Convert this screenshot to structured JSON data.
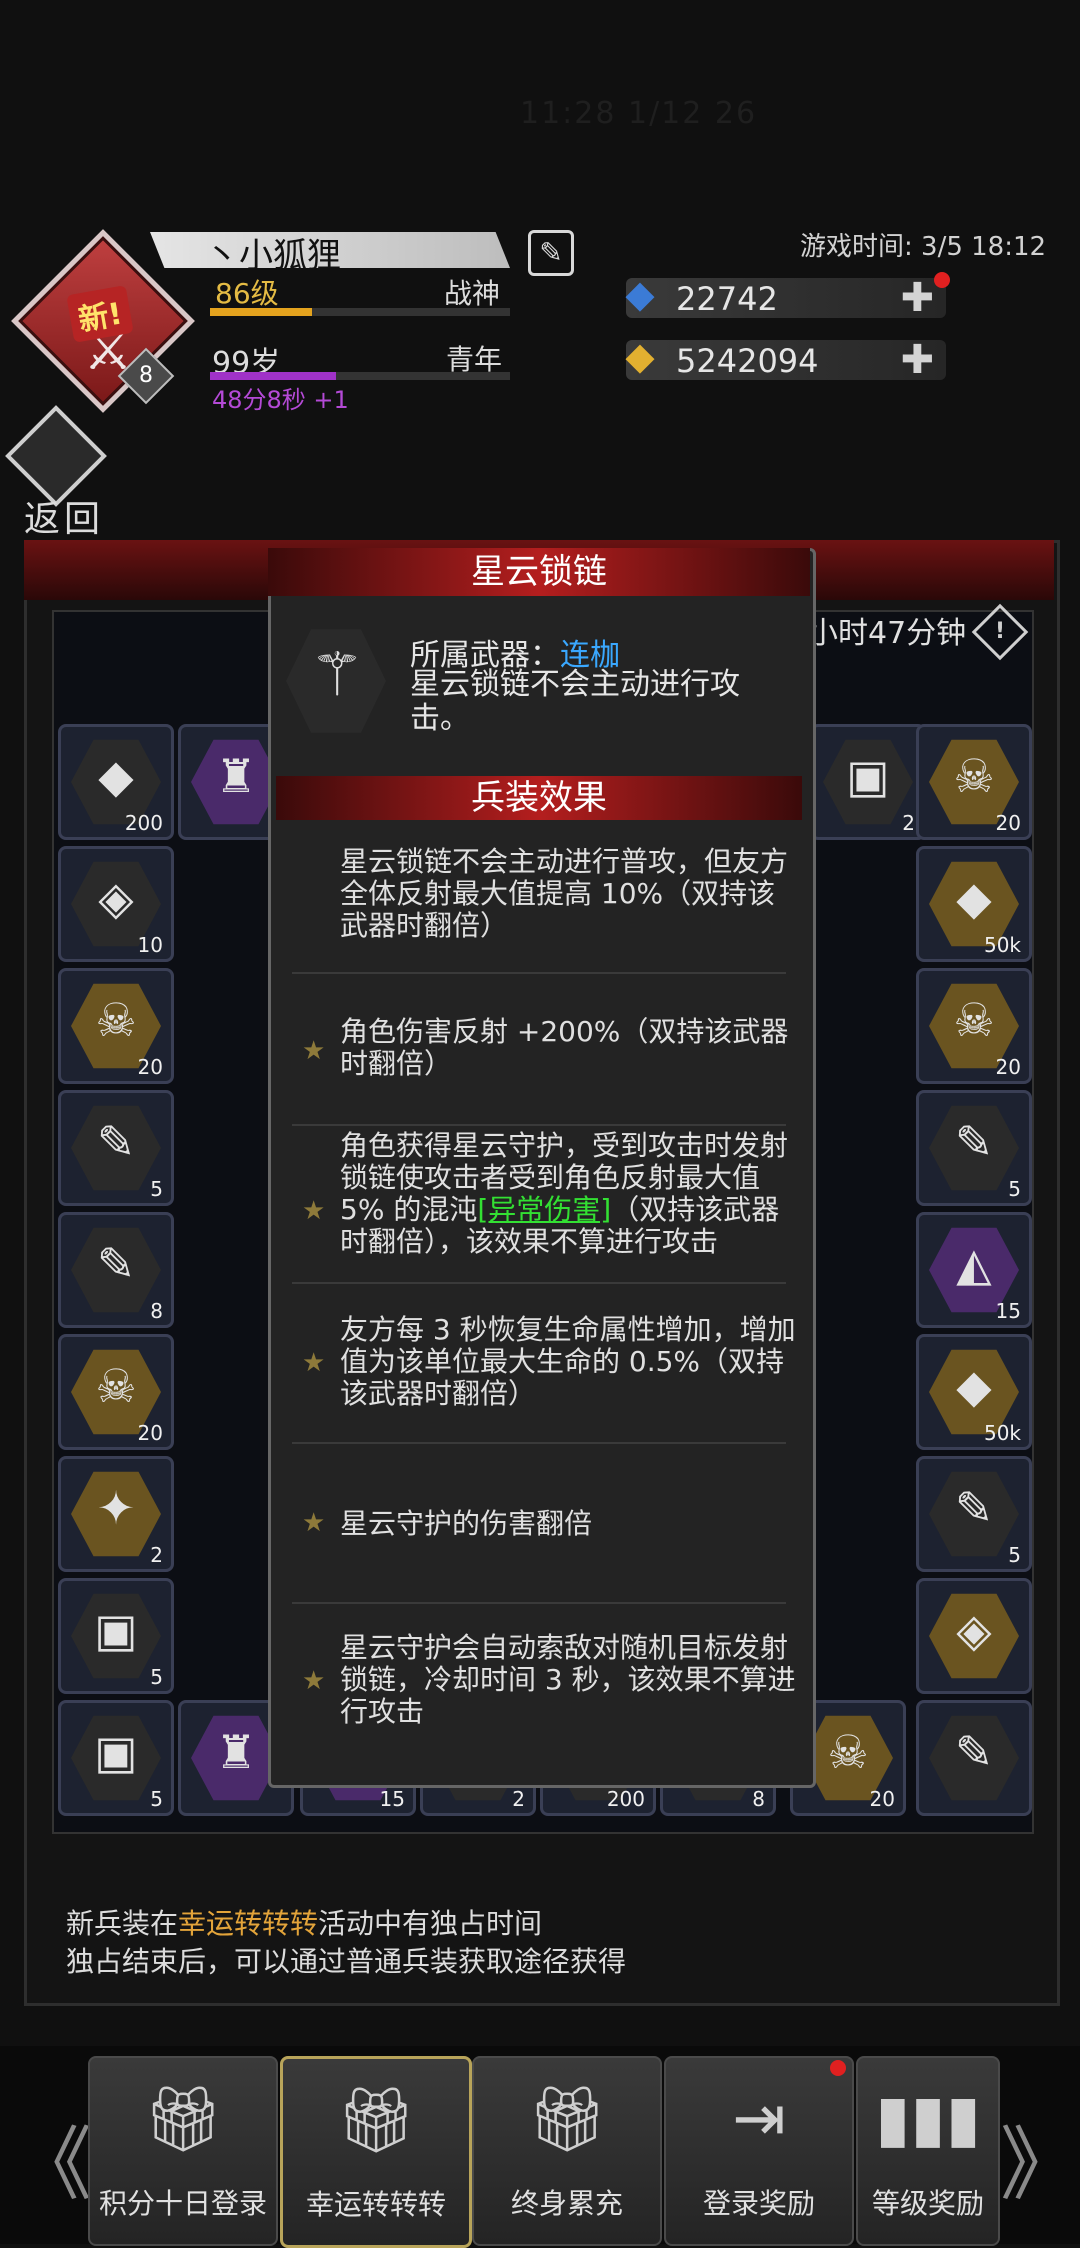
{
  "status_bar": {
    "time_faint": "11:28 1/12  26"
  },
  "player": {
    "name": "丶小狐狸",
    "level": "86级",
    "rank": "战神",
    "level_progress": 0.34,
    "age": "99岁",
    "stage": "青年",
    "age_progress": 0.42,
    "timer": "48分8秒 +1",
    "badge_new": "新!",
    "avatar_level": "8"
  },
  "game_time": "游戏时间: 3/5 18:12",
  "resources": [
    {
      "icon": "blue-gem-icon",
      "value": "22742"
    },
    {
      "icon": "gold-gem-icon",
      "value": "5242094"
    }
  ],
  "back_label": "返回",
  "panel": {
    "timer_right": "小时47分钟",
    "info_icon": "!"
  },
  "slots": [
    {
      "glyph": "◆",
      "count": "200"
    },
    {
      "glyph": "♜",
      "count": ""
    },
    {
      "glyph": "▣",
      "count": "2"
    },
    {
      "glyph": "☠",
      "count": "20"
    },
    {
      "glyph": "◈",
      "count": "10"
    },
    {
      "glyph": "◆",
      "count": "50k"
    },
    {
      "glyph": "☠",
      "count": "20"
    },
    {
      "glyph": "☠",
      "count": "20"
    },
    {
      "glyph": "✎",
      "count": "5"
    },
    {
      "glyph": "✎",
      "count": "5"
    },
    {
      "glyph": "✎",
      "count": "8"
    },
    {
      "glyph": "◭",
      "count": "15"
    },
    {
      "glyph": "☠",
      "count": "20"
    },
    {
      "glyph": "◆",
      "count": "50k"
    },
    {
      "glyph": "✦",
      "count": "2"
    },
    {
      "glyph": "✎",
      "count": "5"
    },
    {
      "glyph": "▣",
      "count": "5"
    },
    {
      "glyph": "◈",
      "count": ""
    },
    {
      "glyph": "▣",
      "count": "5"
    },
    {
      "glyph": "♜",
      "count": ""
    },
    {
      "glyph": "◭",
      "count": "15"
    },
    {
      "glyph": "◆",
      "count": "2"
    },
    {
      "glyph": "◆",
      "count": "200"
    },
    {
      "glyph": "✎",
      "count": "8"
    },
    {
      "glyph": "☠",
      "count": "20"
    },
    {
      "glyph": "✎",
      "count": ""
    }
  ],
  "notes": {
    "line1_pre": "新兵装在",
    "line1_hl": "幸运转转转",
    "line1_post": "活动中有独占时间",
    "line2": "独占结束后，可以通过普通兵装获取途径获得"
  },
  "modal": {
    "title": "星云锁链",
    "weapon_label": "所属武器：",
    "weapon_link": "连枷",
    "weapon_desc": "星云锁链不会主动进行攻击。",
    "section_title": "兵装效果",
    "effects": [
      {
        "star": false,
        "text": "星云锁链不会主动进行普攻，但友方全体反射最大值提高 10%（双持该武器时翻倍）"
      },
      {
        "star": true,
        "text": "角色伤害反射 +200%（双持该武器时翻倍）"
      },
      {
        "star": true,
        "text_pre": "角色获得星云守护，受到攻击时发射锁链使攻击者受到角色反射最大值 5% 的混沌",
        "text_hl": "[异常伤害]",
        "text_post": "（双持该武器时翻倍），该效果不算进行攻击"
      },
      {
        "star": true,
        "text": "友方每 3 秒恢复生命属性增加，增加值为该单位最大生命的 0.5%（双持该武器时翻倍）"
      },
      {
        "star": true,
        "text": "星云守护的伤害翻倍"
      },
      {
        "star": true,
        "text": "星云守护会自动索敌对随机目标发射锁链，冷却时间 3 秒，该效果不算进行攻击"
      }
    ]
  },
  "nav": {
    "left_arrow": "《",
    "right_arrow": "》",
    "tabs": [
      {
        "label": "积分十日登录",
        "icon": "gift-icon",
        "active": false,
        "dot": false
      },
      {
        "label": "幸运转转转",
        "icon": "gift-icon",
        "active": true,
        "dot": false
      },
      {
        "label": "终身累充",
        "icon": "gift-icon",
        "active": false,
        "dot": false
      },
      {
        "label": "登录奖励",
        "icon": "login-icon",
        "active": false,
        "dot": true
      },
      {
        "label": "等级奖励",
        "icon": "chart-icon",
        "active": false,
        "dot": false
      }
    ]
  }
}
